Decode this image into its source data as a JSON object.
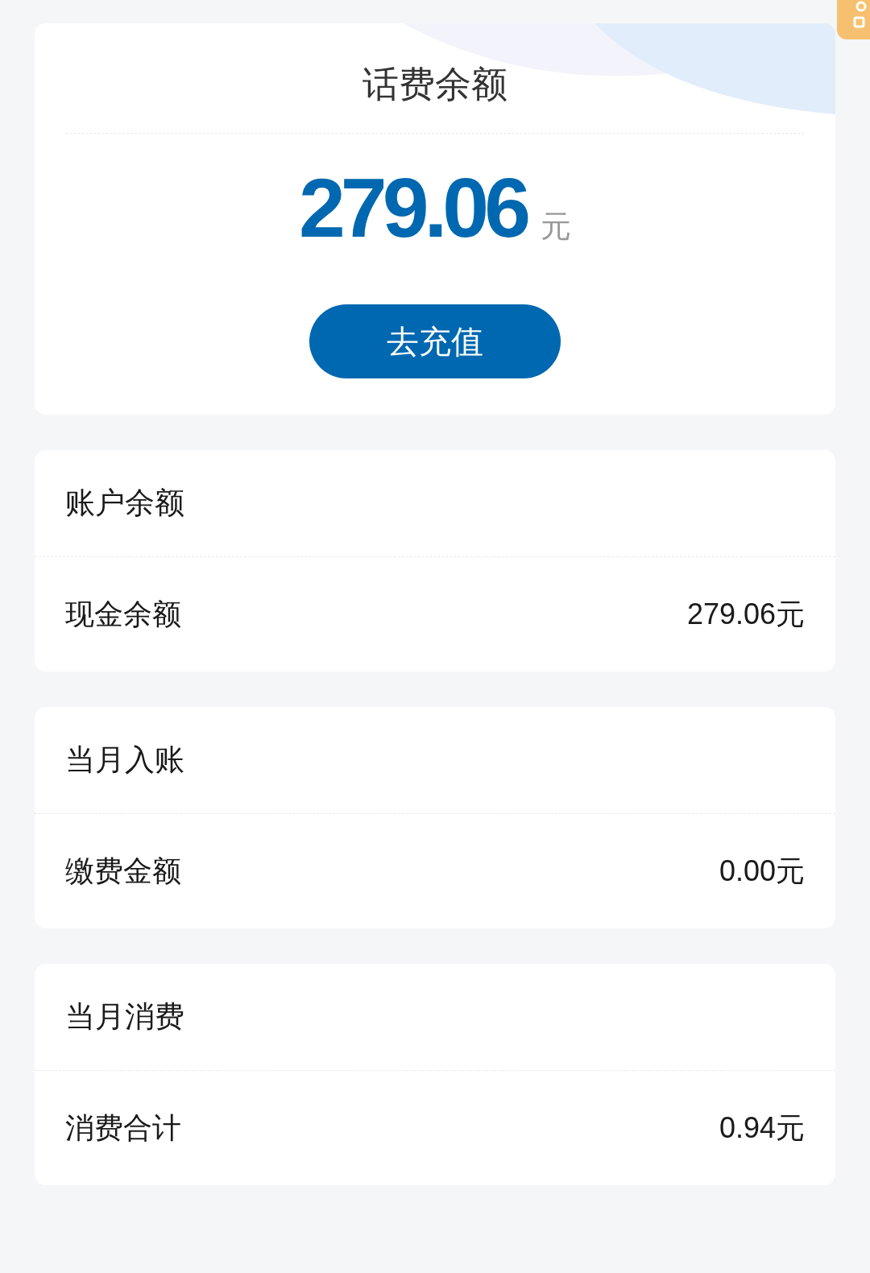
{
  "balance_card": {
    "title": "话费余额",
    "amount": "279.06",
    "unit": "元",
    "recharge_button": "去充值"
  },
  "sections": [
    {
      "title": "账户余额",
      "rows": [
        {
          "label": "现金余额",
          "value": "279.06元"
        }
      ]
    },
    {
      "title": "当月入账",
      "rows": [
        {
          "label": "缴费金额",
          "value": "0.00元"
        }
      ]
    },
    {
      "title": "当月消费",
      "rows": [
        {
          "label": "消费合计",
          "value": "0.94元"
        }
      ]
    }
  ]
}
